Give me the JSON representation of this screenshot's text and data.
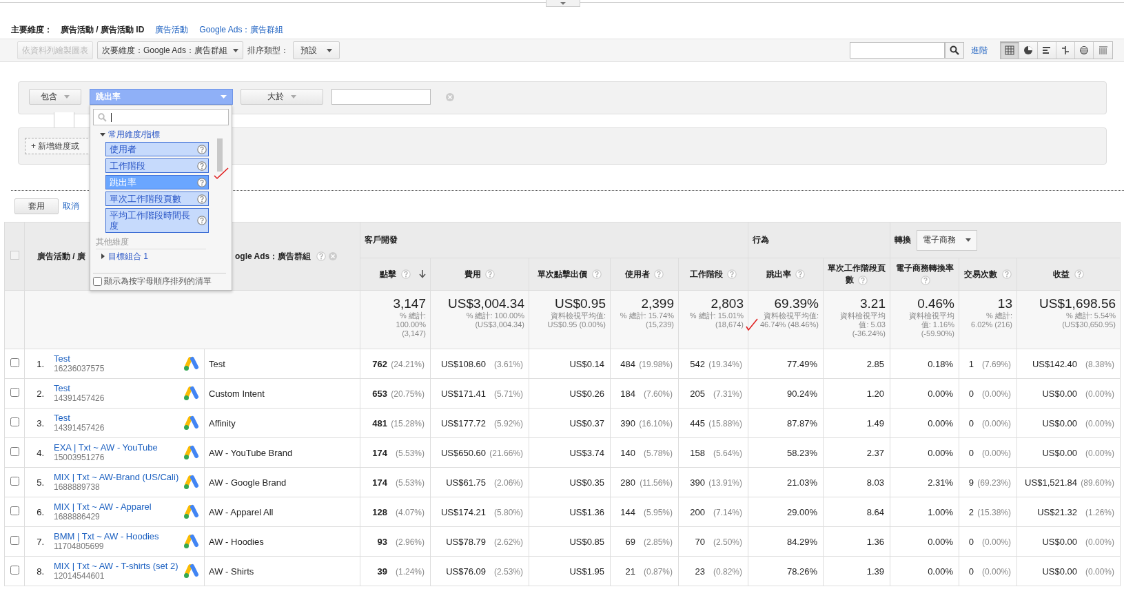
{
  "primary_dimension": {
    "label": "主要維度：",
    "options": [
      {
        "label": "廣告活動 / 廣告活動 ID",
        "selected": true
      },
      {
        "label": "廣告活動",
        "selected": false
      },
      {
        "label": "Google Ads：廣告群組",
        "selected": false
      }
    ]
  },
  "toolbar": {
    "plot_button": {
      "label": "依資料列繪製圖表",
      "disabled": true
    },
    "secondary_dimension": "次要維度：Google Ads：廣告群組",
    "sort_label": "排序類型：",
    "sort_type": "預設",
    "advanced_link": "進階",
    "views": [
      {
        "kind": "table",
        "selected": true
      },
      {
        "kind": "pie",
        "selected": false
      },
      {
        "kind": "bar",
        "selected": false
      },
      {
        "kind": "comparison",
        "selected": false
      },
      {
        "kind": "summary",
        "selected": false
      },
      {
        "kind": "pivot",
        "selected": false
      }
    ]
  },
  "filter": {
    "match": "包含",
    "metric": "跳出率",
    "operator": "大於",
    "add_button": "+ 新增維度或",
    "apply": "套用",
    "cancel": "取消"
  },
  "picker": {
    "groups": [
      {
        "label": "常用維度/指標",
        "expanded": true,
        "items": [
          {
            "label": "使用者",
            "selected": false
          },
          {
            "label": "工作階段",
            "selected": false
          },
          {
            "label": "跳出率",
            "selected": true
          },
          {
            "label": "單次工作階段頁數",
            "selected": false
          },
          {
            "label": "平均工作階段時間長度",
            "selected": false
          }
        ]
      }
    ],
    "other_heading": "其他維度",
    "other_groups": [
      {
        "label": "目標組合 1",
        "expanded": false
      }
    ],
    "alphabetical": {
      "label": "顯示為按字母順序排列的清單",
      "checked": false
    }
  },
  "table": {
    "select_all": {
      "disabled": true
    },
    "campaign_header": "廣告活動 / 廣",
    "ad_group_header": "ogle Ads：廣告群組",
    "groups": [
      {
        "label": "客戶開發",
        "columns": [
          {
            "label": "點擊",
            "sorted": true
          },
          {
            "label": "費用",
            "sorted": false
          },
          {
            "label": "單次點擊出價",
            "sorted": false
          },
          {
            "label": "使用者",
            "sorted": false
          },
          {
            "label": "工作階段",
            "sorted": false
          }
        ]
      },
      {
        "label": "行為",
        "columns": [
          {
            "label": "跳出率",
            "sorted": false
          },
          {
            "label": "單次工作階段頁數",
            "sorted": false
          }
        ]
      },
      {
        "label": "轉換",
        "dropdown": "電子商務",
        "columns": [
          {
            "label": "電子商務轉換率",
            "sorted": false
          },
          {
            "label": "交易次數",
            "sorted": false
          },
          {
            "label": "收益",
            "sorted": false
          }
        ]
      }
    ],
    "totals": [
      {
        "value": "3,147",
        "note": [
          "% 總計:",
          "100.00%",
          "(3,147)"
        ]
      },
      {
        "value": "US$3,004.34",
        "note": [
          "% 總計: 100.00%",
          "(US$3,004.34)"
        ]
      },
      {
        "value": "US$0.95",
        "note": [
          "資料檢視平均值:",
          "US$0.95 (0.00%)"
        ]
      },
      {
        "value": "2,399",
        "note": [
          "% 總計: 15.74%",
          "(15,239)"
        ]
      },
      {
        "value": "2,803",
        "note": [
          "% 總計: 15.01%",
          "(18,674)"
        ]
      },
      {
        "value": "69.39%",
        "note": [
          "資料檢視平均值:",
          "46.74% (48.46%)"
        ]
      },
      {
        "value": "3.21",
        "note": [
          "資料檢視平均",
          "值: 5.03",
          "(-36.24%)"
        ]
      },
      {
        "value": "0.46%",
        "note": [
          "資料檢視平均",
          "值: 1.16%",
          "(-59.90%)"
        ]
      },
      {
        "value": "13",
        "note": [
          "% 總計:",
          "6.02% (216)"
        ]
      },
      {
        "value": "US$1,698.56",
        "note": [
          "% 總計: 5.54%",
          "(US$30,650.95)"
        ]
      }
    ],
    "rows": [
      {
        "number": "1.",
        "checked": false,
        "campaign": "Test",
        "campaign_id": "16236037575",
        "ad_group": "Test",
        "cells": [
          {
            "v": "762",
            "s": "(24.21%)"
          },
          {
            "v": "US$108.60",
            "s": "(3.61%)"
          },
          {
            "v": "US$0.14"
          },
          {
            "v": "484",
            "s": "(19.98%)"
          },
          {
            "v": "542",
            "s": "(19.34%)"
          },
          {
            "v": "77.49%"
          },
          {
            "v": "2.85"
          },
          {
            "v": "0.18%"
          },
          {
            "v": "1",
            "s": "(7.69%)"
          },
          {
            "v": "US$142.40",
            "s": "(8.38%)"
          }
        ]
      },
      {
        "number": "2.",
        "checked": false,
        "campaign": "Test",
        "campaign_id": "14391457426",
        "ad_group": "Custom Intent",
        "cells": [
          {
            "v": "653",
            "s": "(20.75%)"
          },
          {
            "v": "US$171.41",
            "s": "(5.71%)"
          },
          {
            "v": "US$0.26"
          },
          {
            "v": "184",
            "s": "(7.60%)"
          },
          {
            "v": "205",
            "s": "(7.31%)"
          },
          {
            "v": "90.24%"
          },
          {
            "v": "1.20"
          },
          {
            "v": "0.00%"
          },
          {
            "v": "0",
            "s": "(0.00%)"
          },
          {
            "v": "US$0.00",
            "s": "(0.00%)"
          }
        ]
      },
      {
        "number": "3.",
        "checked": false,
        "campaign": "Test",
        "campaign_id": "14391457426",
        "ad_group": "Affinity",
        "cells": [
          {
            "v": "481",
            "s": "(15.28%)"
          },
          {
            "v": "US$177.72",
            "s": "(5.92%)"
          },
          {
            "v": "US$0.37"
          },
          {
            "v": "390",
            "s": "(16.10%)"
          },
          {
            "v": "445",
            "s": "(15.88%)"
          },
          {
            "v": "87.87%"
          },
          {
            "v": "1.49"
          },
          {
            "v": "0.00%"
          },
          {
            "v": "0",
            "s": "(0.00%)"
          },
          {
            "v": "US$0.00",
            "s": "(0.00%)"
          }
        ]
      },
      {
        "number": "4.",
        "checked": false,
        "campaign": "EXA | Txt ~ AW - YouTube",
        "campaign_id": "15003951276",
        "ad_group": "AW - YouTube Brand",
        "cells": [
          {
            "v": "174",
            "s": "(5.53%)"
          },
          {
            "v": "US$650.60",
            "s": "(21.66%)"
          },
          {
            "v": "US$3.74"
          },
          {
            "v": "140",
            "s": "(5.78%)"
          },
          {
            "v": "158",
            "s": "(5.64%)"
          },
          {
            "v": "58.23%"
          },
          {
            "v": "2.37"
          },
          {
            "v": "0.00%"
          },
          {
            "v": "0",
            "s": "(0.00%)"
          },
          {
            "v": "US$0.00",
            "s": "(0.00%)"
          }
        ]
      },
      {
        "number": "5.",
        "checked": false,
        "campaign": "MIX | Txt ~ AW-Brand (US/Cali)",
        "campaign_id": "1688889738",
        "ad_group": "AW - Google Brand",
        "cells": [
          {
            "v": "174",
            "s": "(5.53%)"
          },
          {
            "v": "US$61.75",
            "s": "(2.06%)"
          },
          {
            "v": "US$0.35"
          },
          {
            "v": "280",
            "s": "(11.56%)"
          },
          {
            "v": "390",
            "s": "(13.91%)"
          },
          {
            "v": "21.03%"
          },
          {
            "v": "8.03"
          },
          {
            "v": "2.31%"
          },
          {
            "v": "9",
            "s": "(69.23%)"
          },
          {
            "v": "US$1,521.84",
            "s": "(89.60%)"
          }
        ]
      },
      {
        "number": "6.",
        "checked": false,
        "campaign": "MIX | Txt ~ AW - Apparel",
        "campaign_id": "1688886429",
        "ad_group": "AW - Apparel All",
        "cells": [
          {
            "v": "128",
            "s": "(4.07%)"
          },
          {
            "v": "US$174.21",
            "s": "(5.80%)"
          },
          {
            "v": "US$1.36"
          },
          {
            "v": "144",
            "s": "(5.95%)"
          },
          {
            "v": "200",
            "s": "(7.14%)"
          },
          {
            "v": "29.00%"
          },
          {
            "v": "8.64"
          },
          {
            "v": "1.00%"
          },
          {
            "v": "2",
            "s": "(15.38%)"
          },
          {
            "v": "US$21.32",
            "s": "(1.26%)"
          }
        ]
      },
      {
        "number": "7.",
        "checked": false,
        "campaign": "BMM | Txt ~ AW - Hoodies",
        "campaign_id": "11704805699",
        "ad_group": "AW - Hoodies",
        "cells": [
          {
            "v": "93",
            "s": "(2.96%)"
          },
          {
            "v": "US$78.79",
            "s": "(2.62%)"
          },
          {
            "v": "US$0.85"
          },
          {
            "v": "69",
            "s": "(2.85%)"
          },
          {
            "v": "70",
            "s": "(2.50%)"
          },
          {
            "v": "84.29%"
          },
          {
            "v": "1.36"
          },
          {
            "v": "0.00%"
          },
          {
            "v": "0",
            "s": "(0.00%)"
          },
          {
            "v": "US$0.00",
            "s": "(0.00%)"
          }
        ]
      },
      {
        "number": "8.",
        "checked": false,
        "campaign": "MIX | Txt ~ AW - T-shirts (set 2)",
        "campaign_id": "12014544601",
        "ad_group": "AW - Shirts",
        "cells": [
          {
            "v": "39",
            "s": "(1.24%)"
          },
          {
            "v": "US$76.09",
            "s": "(2.53%)"
          },
          {
            "v": "US$1.95"
          },
          {
            "v": "21",
            "s": "(0.87%)"
          },
          {
            "v": "23",
            "s": "(0.82%)"
          },
          {
            "v": "78.26%"
          },
          {
            "v": "1.39"
          },
          {
            "v": "0.00%"
          },
          {
            "v": "0",
            "s": "(0.00%)"
          },
          {
            "v": "US$0.00",
            "s": "(0.00%)"
          }
        ]
      }
    ]
  }
}
